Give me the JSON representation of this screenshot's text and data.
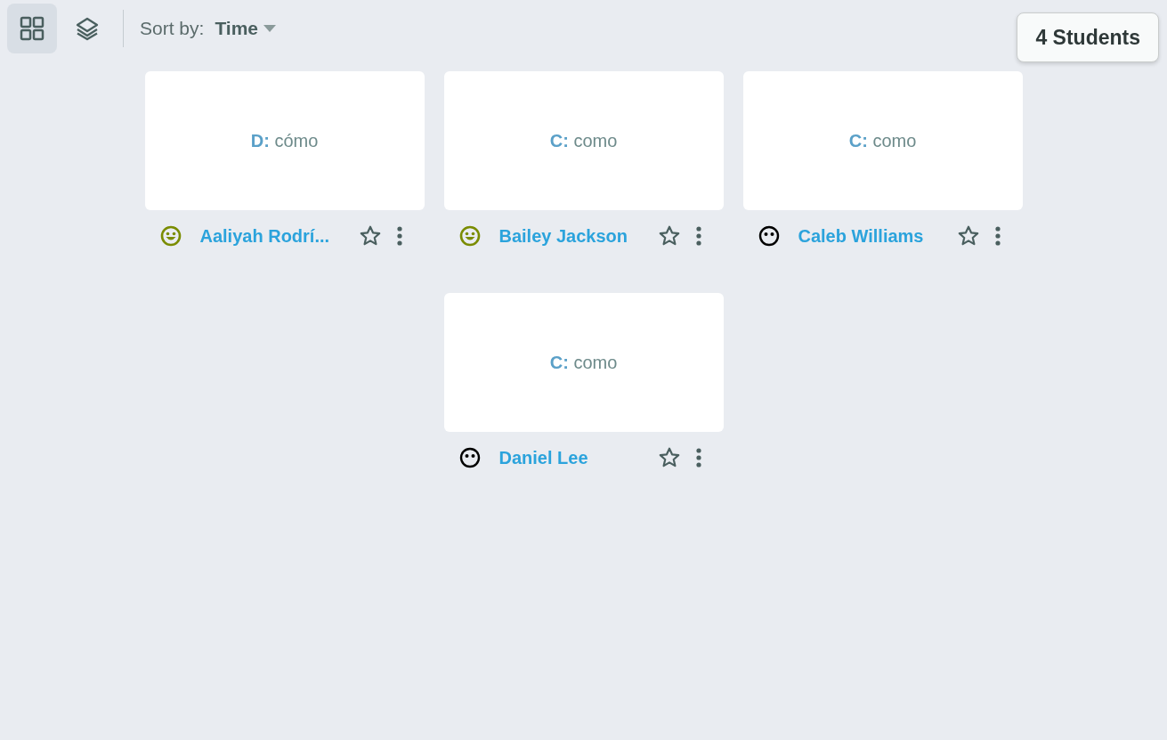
{
  "toolbar": {
    "views": [
      {
        "kind": "grid",
        "selected": true
      },
      {
        "kind": "layers",
        "selected": false
      }
    ],
    "sort_label": "Sort by:",
    "sort_value": "Time"
  },
  "count_button": "4 Students",
  "students": [
    {
      "answer_choice": "D:",
      "answer_text": "cómo",
      "kind": "happy",
      "name": "Aaliyah Rodrí..."
    },
    {
      "answer_choice": "C:",
      "answer_text": "como",
      "kind": "happy",
      "name": "Bailey Jackson"
    },
    {
      "answer_choice": "C:",
      "answer_text": "como",
      "kind": "neutral",
      "name": "Caleb Williams"
    },
    {
      "answer_choice": "C:",
      "answer_text": "como",
      "kind": "neutral",
      "name": "Daniel Lee"
    }
  ]
}
